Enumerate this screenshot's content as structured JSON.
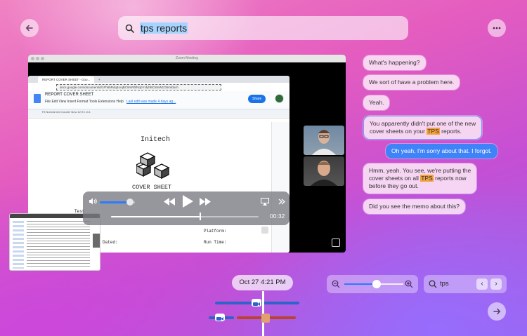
{
  "search": {
    "query": "tps reports"
  },
  "zoom_window": {
    "title": "Zoom Meeting",
    "browser_tab": "REPORT COVER SHEET - Goo...",
    "url": "docs.google.com/document/d/1Fh6bRdq4sAjBC9mRbfNq0YxfyhBC8mW1O5mfdoch",
    "doc_title": "REPORT COVER SHEET",
    "doc_menu": "File   Edit   View   Insert   Format   Tools   Extensions   Help",
    "last_edit": "Last edit was made 4 days ag...",
    "share_label": "Share",
    "toolbar": "Fit     Normal text     Courier New     12     B  I  U  A",
    "doc_company": "Initech",
    "doc_heading": "COVER SHEET",
    "field_test": "Test",
    "field_platform": "Platform:",
    "field_dated": "Dated:",
    "field_runtime": "Run Time:"
  },
  "media": {
    "time": "00:32",
    "volume_fraction": 0.85,
    "progress_fraction": 0.6
  },
  "chat": [
    {
      "text": "What's happening?",
      "dir": "in"
    },
    {
      "text": "We sort of have a problem here.",
      "dir": "in"
    },
    {
      "text": "Yeah.",
      "dir": "in"
    },
    {
      "text_parts": [
        "You apparently didn't put one of the new",
        "cover sheets on your ",
        "TPS",
        " reports."
      ],
      "dir": "in"
    },
    {
      "text": "Oh yeah, I'm sorry about that. I forgot.",
      "dir": "out"
    },
    {
      "text_parts": [
        "Hmm, yeah. You see, we're putting the",
        "cover sheets on all ",
        "TPS",
        " reports now",
        "before they go out."
      ],
      "dir": "in"
    },
    {
      "text": "Did you see the memo about this?",
      "dir": "in"
    }
  ],
  "timeline": {
    "date": "Oct 27 4:21 PM"
  },
  "zoom_level_fraction": 0.55,
  "find": {
    "query": "tps"
  },
  "colors": {
    "accent": "#3f83f8",
    "highlight": "#f3a13b"
  }
}
